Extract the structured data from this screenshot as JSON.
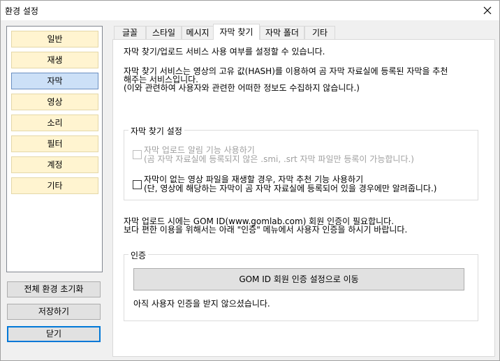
{
  "window": {
    "title": "환경 설정"
  },
  "sidebar": {
    "items": [
      {
        "label": "일반"
      },
      {
        "label": "재생"
      },
      {
        "label": "자막"
      },
      {
        "label": "영상"
      },
      {
        "label": "소리"
      },
      {
        "label": "필터"
      },
      {
        "label": "계정"
      },
      {
        "label": "기타"
      }
    ],
    "active": "자막"
  },
  "buttons": {
    "reset_all": "전체 환경 초기화",
    "save": "저장하기",
    "close": "닫기"
  },
  "tabs": [
    {
      "label": "글꼴"
    },
    {
      "label": "스타일"
    },
    {
      "label": "메시지"
    },
    {
      "label": "자막 찾기"
    },
    {
      "label": "자막 폴더"
    },
    {
      "label": "기타"
    }
  ],
  "panel": {
    "intro_line1": "자막 찾기/업로드 서비스 사용 여부를 설정할 수 있습니다.",
    "intro_line2": "자막 찾기 서비스는 영상의 고유 값(HASH)를 이용하여 곰 자막 자료실에 등록된 자막을 추천",
    "intro_line3": "해주는 서비스입니다.",
    "intro_line4": "(이와 관련하여 사용자와 관련한 어떠한 정보도 수집하지 않습니다.)",
    "search_group": {
      "label": "자막 찾기 설정",
      "opt1_label": "자막 업로드 알림 기능 사용하기",
      "opt1_note": "(곰 자막 자료실에 등록되지 않은 .smi, .srt 자막 파일만 등록이 가능합니다.)",
      "opt2_label": "자막이 없는 영상 파일을 재생할 경우, 자막 추천 기능 사용하기",
      "opt2_note": "(단, 영상에 해당하는 자막이 곰 자막 자료실에 등록되어 있을 경우에만 알려줍니다.)"
    },
    "upload_note1": "자막 업로드 시에는 GOM ID(www.gomlab.com) 회원 인증이 필요합니다.",
    "upload_note2": "보다 편한 이용을 위해서는 아래 \"인증\" 메뉴에서 사용자 인증을 하시기 바랍니다.",
    "auth_group": {
      "label": "인증",
      "button": "GOM ID 회원 인증 설정으로 이동",
      "status": "아직 사용자 인증을 받지 않으셨습니다."
    }
  }
}
